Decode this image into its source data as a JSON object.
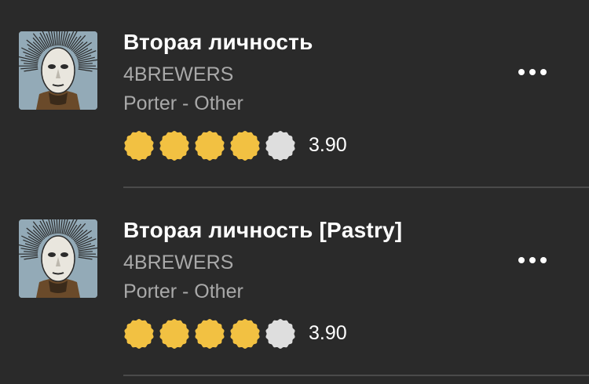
{
  "colors": {
    "background": "#2a2a2a",
    "cap_filled": "#f2c142",
    "cap_empty": "#dedede",
    "title": "#ffffff",
    "secondary_text": "#a9a9a9",
    "divider": "#4a4a4a"
  },
  "beers": [
    {
      "name": "Вторая личность",
      "brewery": "4BREWERS",
      "style": "Porter - Other",
      "rating": 3.9,
      "rating_label": "3.90",
      "caps_filled": 4,
      "caps_total": 5,
      "thumbnail_icon": "mask-label-image",
      "menu_icon": "more-horizontal-icon"
    },
    {
      "name": "Вторая личность [Pastry]",
      "brewery": "4BREWERS",
      "style": "Porter - Other",
      "rating": 3.9,
      "rating_label": "3.90",
      "caps_filled": 4,
      "caps_total": 5,
      "thumbnail_icon": "mask-label-image",
      "menu_icon": "more-horizontal-icon"
    }
  ]
}
